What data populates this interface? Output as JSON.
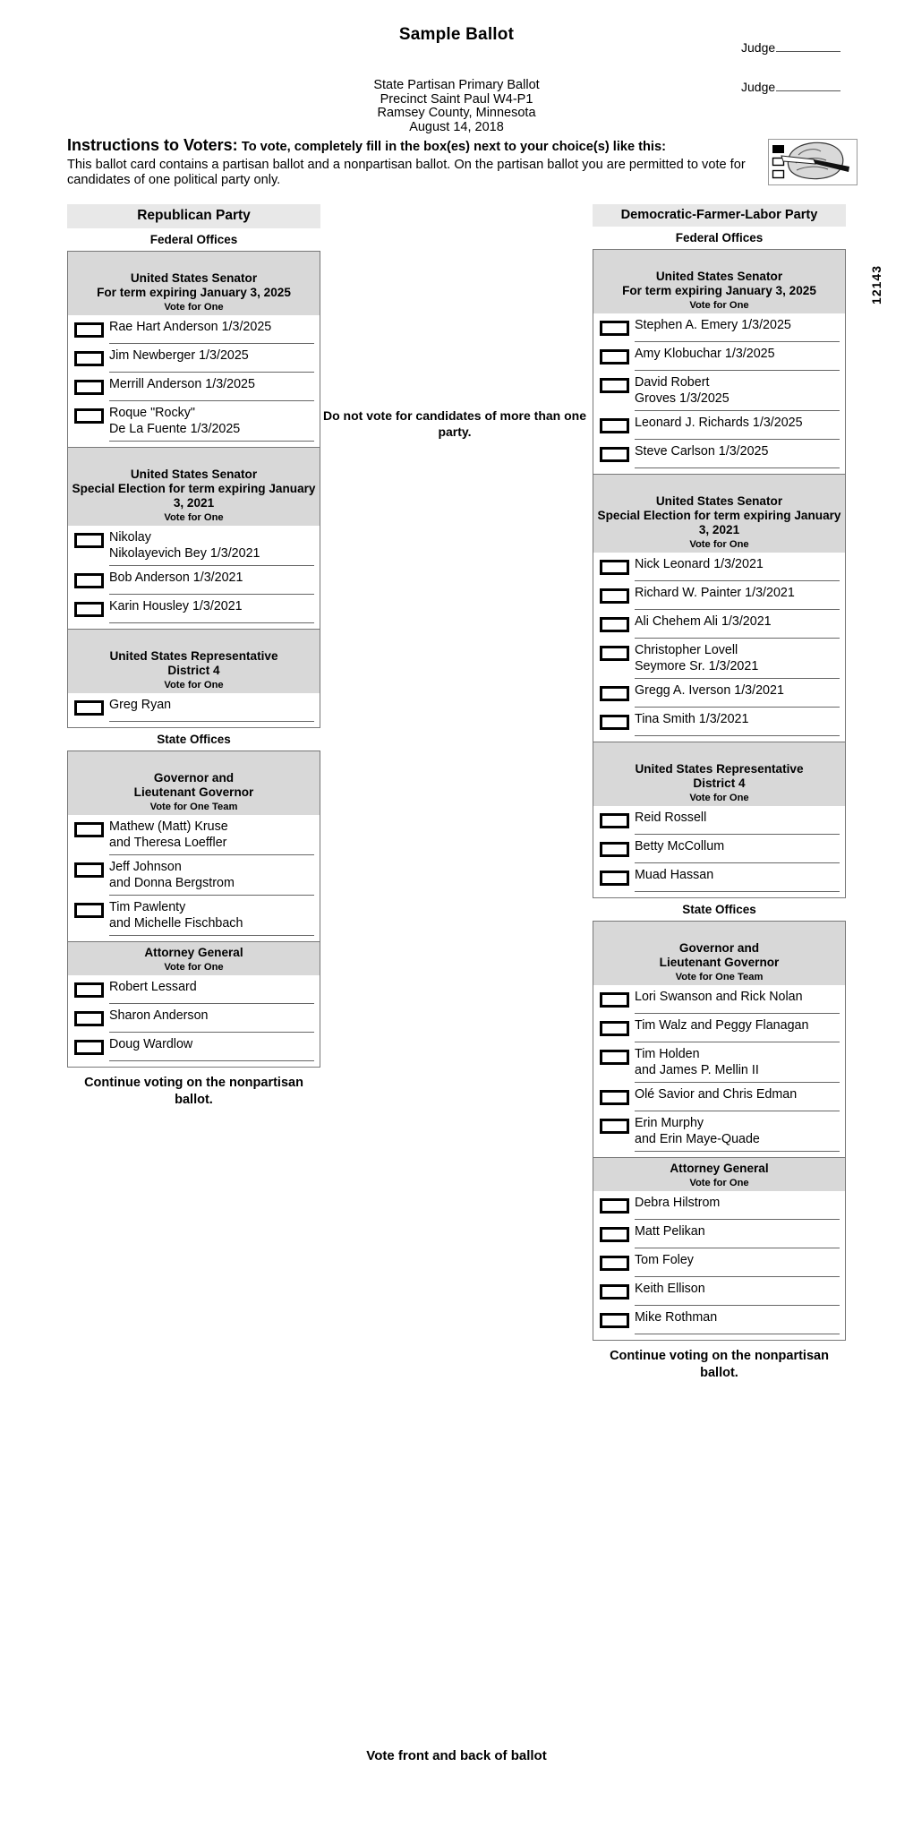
{
  "header": {
    "title": "Sample Ballot",
    "judges": [
      "Judge",
      "Judge"
    ],
    "election_lines": [
      "State Partisan Primary Ballot",
      "Precinct Saint Paul W4-P1",
      "Ramsey County, Minnesota",
      "August 14, 2018"
    ],
    "ballot_id": "12143"
  },
  "instructions": {
    "heading": "Instructions to Voters:",
    "subheading": "To vote, completely fill in the box(es) next to your choice(s) like this:",
    "body": "This ballot card contains a partisan ballot and a nonpartisan ballot. On the partisan ballot you are permitted to vote for candidates of one political party only.",
    "mark_example_icon": "hand-with-pencil-filling-box-icon"
  },
  "center_note": "Do not vote for candidates of more than one party.",
  "continue_note": "Continue voting on the nonpartisan ballot.",
  "footer_note": "Vote front and back of ballot",
  "columns": [
    {
      "party": "Republican Party",
      "sections": [
        {
          "label": "Federal Offices",
          "contests": [
            {
              "title": "United States Senator\nFor term expiring January 3, 2025",
              "vote_for": "Vote for One",
              "candidates": [
                "Rae Hart Anderson 1/3/2025",
                "Jim Newberger 1/3/2025",
                "Merrill Anderson 1/3/2025",
                "Roque \"Rocky\"\nDe La Fuente 1/3/2025"
              ]
            },
            {
              "title": "United States Senator\nSpecial Election for term expiring January 3, 2021",
              "vote_for": "Vote for One",
              "candidates": [
                "Nikolay\nNikolayevich Bey 1/3/2021",
                "Bob Anderson 1/3/2021",
                "Karin Housley 1/3/2021"
              ]
            },
            {
              "title": "United States Representative\nDistrict 4",
              "vote_for": "Vote for One",
              "candidates": [
                "Greg Ryan"
              ]
            }
          ]
        },
        {
          "label": "State Offices",
          "contests": [
            {
              "title": "Governor and\nLieutenant Governor",
              "vote_for": "Vote for One Team",
              "candidates": [
                "Mathew (Matt) Kruse\nand Theresa Loeffler",
                "Jeff Johnson\nand Donna Bergstrom",
                "Tim Pawlenty\nand Michelle Fischbach"
              ]
            },
            {
              "title": "Attorney General",
              "vote_for": "Vote for One",
              "candidates": [
                "Robert Lessard",
                "Sharon Anderson",
                "Doug Wardlow"
              ]
            }
          ]
        }
      ]
    },
    {
      "party": "Democratic-Farmer-Labor Party",
      "sections": [
        {
          "label": "Federal Offices",
          "contests": [
            {
              "title": "United States Senator\nFor term expiring January 3, 2025",
              "vote_for": "Vote for One",
              "candidates": [
                "Stephen A. Emery 1/3/2025",
                "Amy Klobuchar 1/3/2025",
                "David Robert\nGroves 1/3/2025",
                "Leonard J. Richards 1/3/2025",
                "Steve Carlson 1/3/2025"
              ]
            },
            {
              "title": "United States Senator\nSpecial Election for term expiring January 3, 2021",
              "vote_for": "Vote for One",
              "candidates": [
                "Nick Leonard 1/3/2021",
                "Richard W. Painter 1/3/2021",
                "Ali Chehem Ali 1/3/2021",
                "Christopher Lovell\nSeymore Sr.  1/3/2021",
                "Gregg A. Iverson 1/3/2021",
                "Tina Smith 1/3/2021"
              ]
            },
            {
              "title": "United States Representative\nDistrict 4",
              "vote_for": "Vote for One",
              "candidates": [
                "Reid Rossell",
                "Betty McCollum",
                "Muad Hassan"
              ]
            }
          ]
        },
        {
          "label": "State Offices",
          "contests": [
            {
              "title": "Governor and\nLieutenant Governor",
              "vote_for": "Vote for One Team",
              "candidates": [
                "Lori Swanson and Rick Nolan",
                "Tim Walz and Peggy Flanagan",
                "Tim Holden\nand James P. Mellin II",
                "Olé Savior and Chris Edman",
                "Erin Murphy\nand Erin Maye-Quade"
              ]
            },
            {
              "title": "Attorney General",
              "vote_for": "Vote for One",
              "candidates": [
                "Debra Hilstrom",
                "Matt Pelikan",
                "Tom Foley",
                "Keith Ellison",
                "Mike Rothman"
              ]
            }
          ]
        }
      ]
    }
  ]
}
